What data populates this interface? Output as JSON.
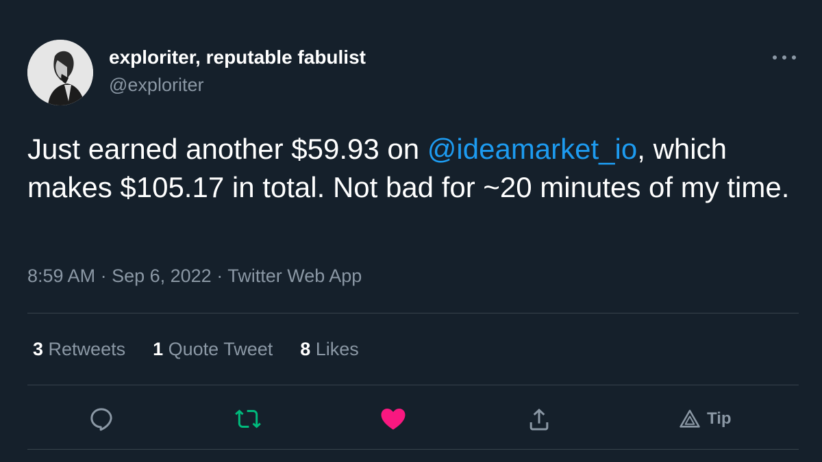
{
  "author": {
    "display_name": "exploriter, reputable fabulist",
    "handle": "@exploriter"
  },
  "tweet": {
    "text_before": "Just earned another $59.93 on ",
    "mention": "@ideamarket_io",
    "text_after": ", which makes $105.17 in total. Not bad for ~20 minutes of my time."
  },
  "meta": {
    "time": "8:59 AM",
    "separator": " · ",
    "date": "Sep 6, 2022",
    "source": "Twitter Web App"
  },
  "stats": {
    "retweets_count": "3",
    "retweets_label": " Retweets",
    "quotes_count": "1",
    "quotes_label": " Quote Tweet",
    "likes_count": "8",
    "likes_label": " Likes"
  },
  "actions": {
    "reply_icon": "reply-icon",
    "retweet_icon": "retweet-icon",
    "like_icon": "heart-icon",
    "share_icon": "share-icon",
    "tip_icon": "tip-icon",
    "tip_label": "Tip"
  },
  "colors": {
    "background": "#15202b",
    "mention": "#1d9bf0",
    "retweet_active": "#00ba7c",
    "like_active": "#f91880",
    "muted": "#8b98a5",
    "divider": "#38444d"
  }
}
